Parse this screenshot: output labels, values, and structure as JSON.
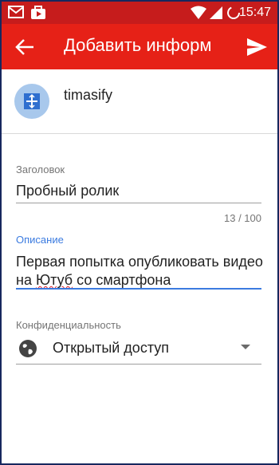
{
  "status_bar": {
    "time": "15:47",
    "icons": [
      "gmail-icon",
      "notification-icon",
      "wifi-icon",
      "signal-icon",
      "battery-loading-icon"
    ]
  },
  "app_bar": {
    "title": "Добавить информ",
    "back_icon": "arrow-left-icon",
    "send_icon": "send-icon",
    "color": "#e62117"
  },
  "account": {
    "name": "timasify",
    "avatar_icon": "account-avatar-icon"
  },
  "title_field": {
    "label": "Заголовок",
    "value": "Пробный ролик",
    "counter": "13 / 100"
  },
  "description_field": {
    "label": "Описание",
    "value_part1": "Первая попытка опубликовать видео на ",
    "value_misspelled": "Ютуб",
    "value_part2": " со смартфона",
    "accent_color": "#3b7be0"
  },
  "privacy_field": {
    "label": "Конфиденциальность",
    "selected": "Открытый доступ",
    "icon": "globe-icon"
  }
}
